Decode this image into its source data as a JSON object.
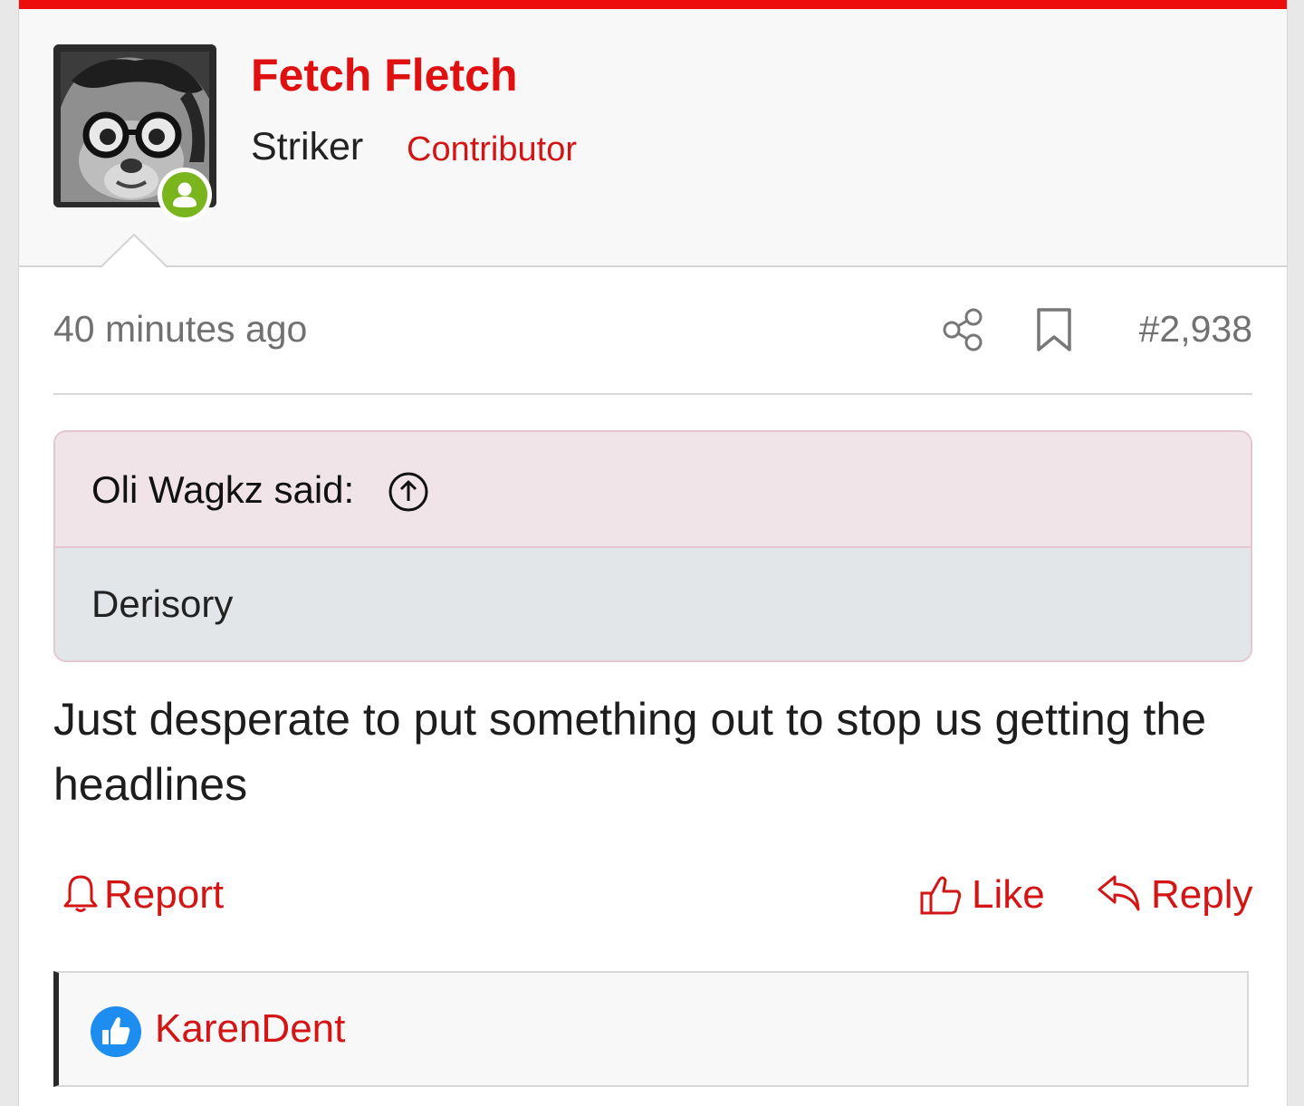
{
  "colors": {
    "accent": "#ee0d0d",
    "link": "#d31515",
    "online": "#7ab51d",
    "quote_header_bg": "#f1e4e8",
    "quote_body_bg": "#e3e6e9",
    "reaction_like": "#1d8ef0"
  },
  "author": {
    "name": "Fetch Fletch",
    "title": "Striker",
    "badge": "Contributor",
    "avatar_icon": "avatar-image",
    "status_icon": "online-user-icon"
  },
  "meta": {
    "time": "40 minutes ago",
    "share_icon": "share-icon",
    "bookmark_icon": "bookmark-icon",
    "post_number": "#2,938"
  },
  "quote": {
    "author_label": "Oli Wagkz said:",
    "jump_icon": "arrow-up-circle-icon",
    "text": "Derisory"
  },
  "message": {
    "text": "Just desperate to put something out to stop us getting the headlines"
  },
  "actions": {
    "report": "Report",
    "like": "Like",
    "reply": "Reply"
  },
  "reactions": {
    "icon": "like-reaction-icon",
    "users": "KarenDent"
  }
}
